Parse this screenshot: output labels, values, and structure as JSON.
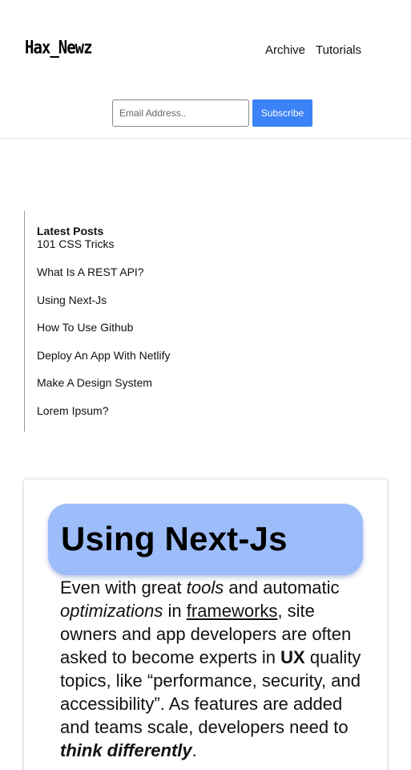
{
  "header": {
    "logo": "Hax_Newz",
    "nav": [
      "Archive",
      "Tutorials"
    ],
    "email_placeholder": "Email Address..",
    "subscribe_label": "Subscribe"
  },
  "latest_posts": {
    "title": "Latest Posts",
    "items": [
      "101 CSS Tricks",
      "What Is A REST API?",
      "Using Next-Js",
      "How To Use Github",
      "Deploy An App With Netlify",
      "Make A Design System",
      "Lorem Ipsum?"
    ]
  },
  "article": {
    "title": "Using Next-Js",
    "body": {
      "t1": "Even with great ",
      "tools": "tools",
      "t2": " and automatic ",
      "optimizations": "optimizations",
      "t3": " in ",
      "frameworks": "frameworks",
      "t4": ", site owners and app developers are often asked to become experts in ",
      "ux": "UX",
      "t5": " quality topics, like “performance, security, and accessibility”. As features are added and teams scale, developers need to ",
      "think": "think differently",
      "t6": "."
    }
  }
}
